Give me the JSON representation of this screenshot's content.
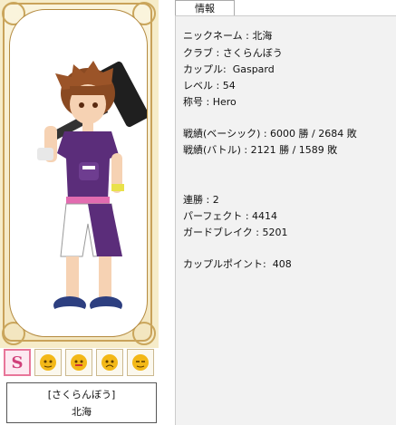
{
  "tab": {
    "label": "情報"
  },
  "profile": {
    "nickname": "ニックネーム : 北海",
    "club": "クラブ : さくらんぼう",
    "couple": "カップル:  Gaspard",
    "level": "レベル : 54",
    "title": "称号 : Hero",
    "record_basic": "戦績(ベーシック) : 6000 勝 / 2684 敗",
    "record_battle": "戦績(バトル) : 2121 勝 / 1589 敗",
    "win_streak": "連勝 : 2",
    "perfect": "パーフェクト : 4414",
    "guard_break": "ガードブレイク : 5201",
    "couple_points": "カップルポイント:  408"
  },
  "nameplate": {
    "club": "[さくらんぼう]",
    "name": "北海"
  },
  "emotes": [
    {
      "icon": "s-letter-icon",
      "selected": true
    },
    {
      "icon": "face-icon",
      "selected": false
    },
    {
      "icon": "face-icon",
      "selected": false
    },
    {
      "icon": "face-icon",
      "selected": false
    },
    {
      "icon": "face-icon",
      "selected": false
    }
  ],
  "colors": {
    "card_bg": "#f6ecc9",
    "frame": "#c9a25a",
    "emote_selected": "#e8769a",
    "panel_bg": "#f2f2f2"
  }
}
